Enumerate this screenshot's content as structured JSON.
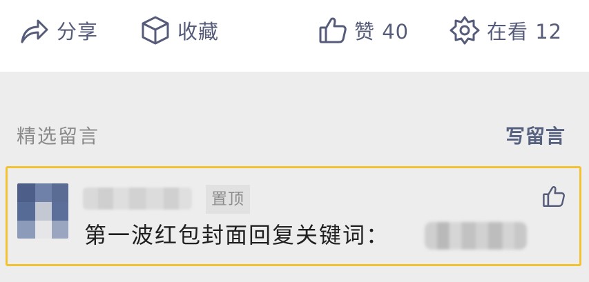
{
  "actions": {
    "share": {
      "label": "分享",
      "icon": "share-icon"
    },
    "collect": {
      "label": "收藏",
      "icon": "cube-icon"
    },
    "like": {
      "label": "赞 40",
      "icon": "thumbs-up-icon"
    },
    "watch": {
      "label": "在看 12",
      "icon": "star-flower-icon"
    }
  },
  "comments_section": {
    "title": "精选留言",
    "write_label": "写留言"
  },
  "comment": {
    "pin_label": "置顶",
    "text": "第一波红包封面回复关键词：",
    "like_icon": "thumbs-up-icon"
  },
  "colors": {
    "icon_gray": "#555b79",
    "highlight_border": "#f2c230",
    "background": "#ededed"
  }
}
